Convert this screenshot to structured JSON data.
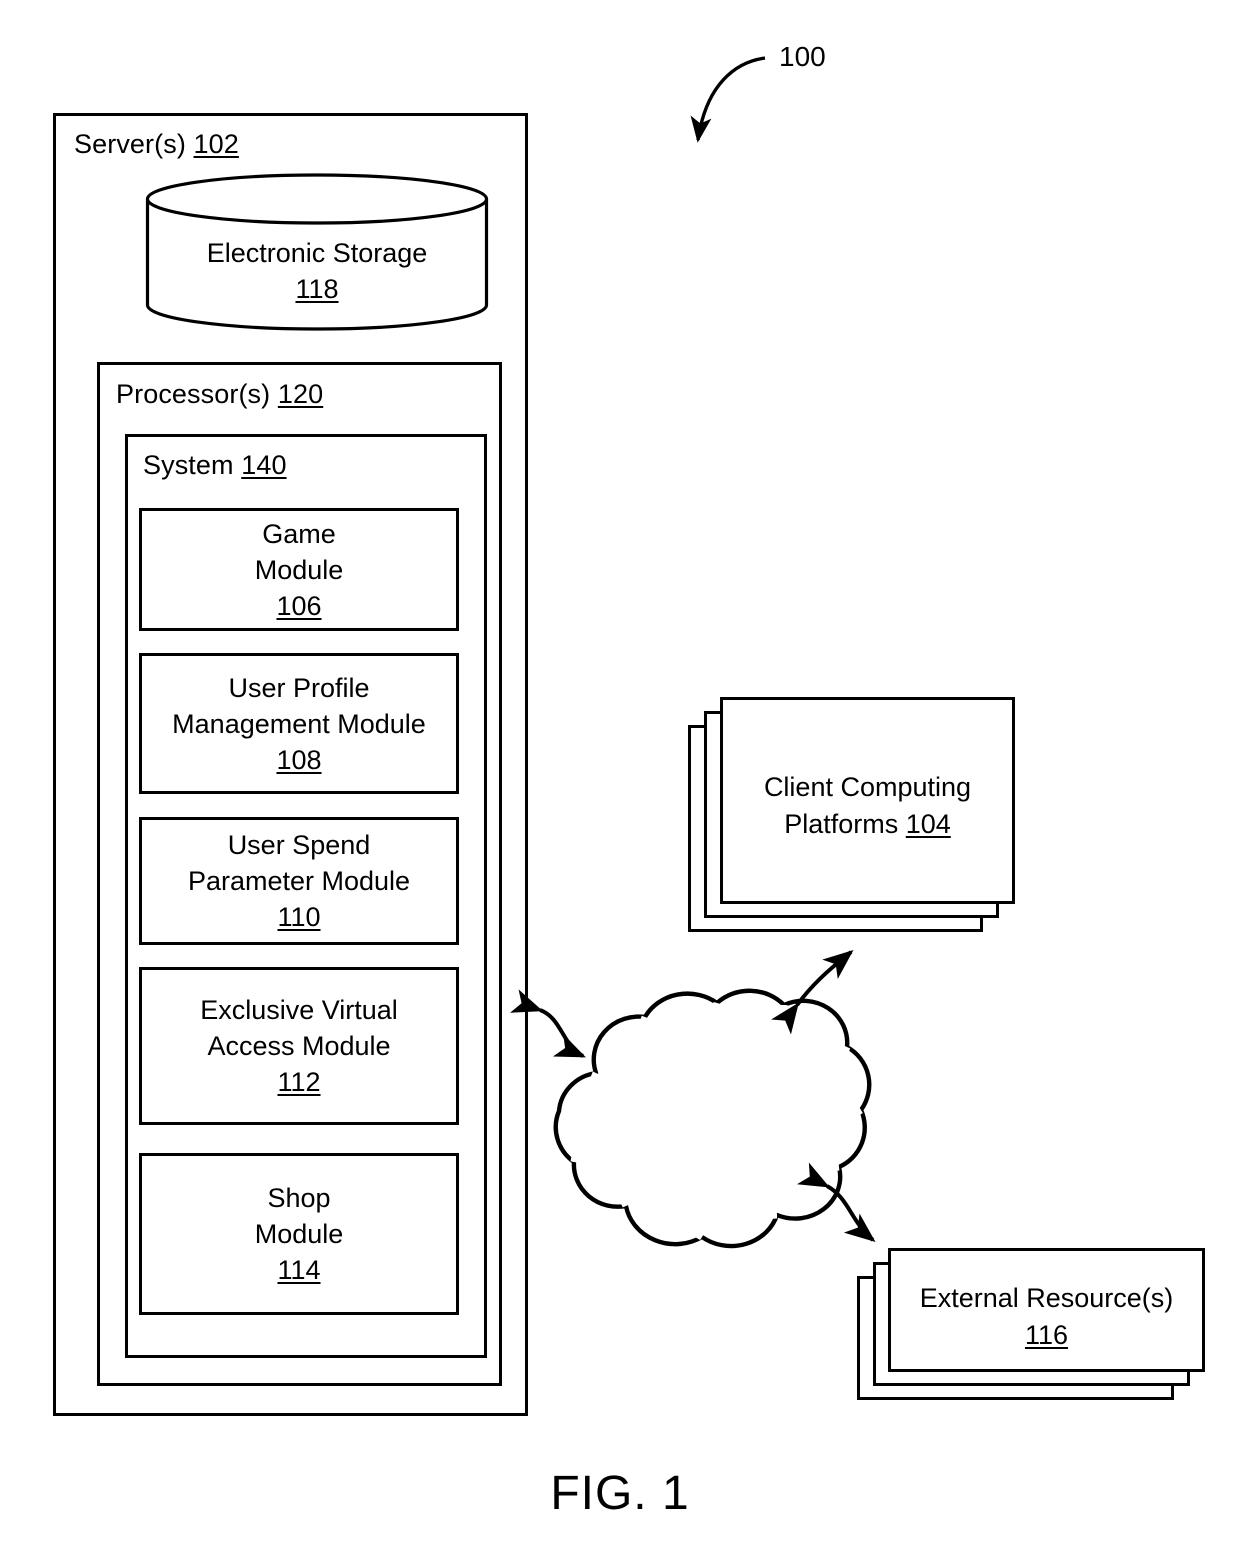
{
  "figure": {
    "caption": "FIG. 1",
    "callout_label": "100"
  },
  "server": {
    "title": "Server(s)",
    "ref": "102",
    "storage": {
      "title": "Electronic Storage",
      "ref": "118"
    },
    "processor": {
      "title": "Processor(s)",
      "ref": "120",
      "system": {
        "title": "System",
        "ref": "140",
        "modules": [
          {
            "name": "Game\nModule",
            "ref": "106"
          },
          {
            "name": "User Profile\nManagement Module",
            "ref": "108"
          },
          {
            "name": "User Spend\nParameter Module",
            "ref": "110"
          },
          {
            "name": "Exclusive  Virtual\nAccess Module",
            "ref": "112"
          },
          {
            "name": "Shop\nModule",
            "ref": "114"
          }
        ]
      }
    }
  },
  "client_platforms": {
    "title": "Client Computing",
    "title_line2": "Platforms",
    "ref": "104"
  },
  "external_resources": {
    "title": "External  Resource(s)",
    "ref": "116"
  },
  "network": {
    "shape": "cloud-icon"
  },
  "colors": {
    "stroke": "#000000",
    "background": "#ffffff"
  }
}
